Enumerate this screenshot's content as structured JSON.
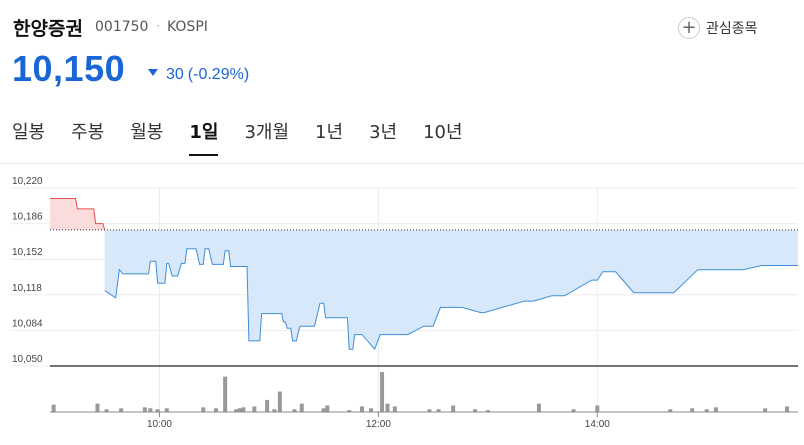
{
  "header": {
    "stock_name": "한양증권",
    "stock_code": "001750",
    "separator": "·",
    "market": "KOSPI",
    "favorite_label": "관심종목",
    "favorite_icon": "plus-circle-icon"
  },
  "quote": {
    "price": "10,150",
    "change": "30",
    "change_pct": "(-0.29%)",
    "direction": "down",
    "color": "#1a66d6"
  },
  "tabs": [
    {
      "label": "일봉",
      "active": false
    },
    {
      "label": "주봉",
      "active": false
    },
    {
      "label": "월봉",
      "active": false
    },
    {
      "label": "1일",
      "active": true
    },
    {
      "label": "3개월",
      "active": false
    },
    {
      "label": "1년",
      "active": false
    },
    {
      "label": "3년",
      "active": false
    },
    {
      "label": "10년",
      "active": false
    }
  ],
  "chart_data": {
    "type": "area",
    "x_unit": "minutes since 09:00",
    "reference_price": 10180,
    "up_color": "#e05050",
    "down_color": "#3f8fd8",
    "ylim": [
      10050,
      10220
    ],
    "yticks": [
      "10,220",
      "10,186",
      "10,152",
      "10,118",
      "10,084",
      "10,050"
    ],
    "ytick_values": [
      10220,
      10186,
      10152,
      10118,
      10084,
      10050
    ],
    "xticks": [
      "10:00",
      "12:00",
      "14:00"
    ],
    "xtick_values": [
      60,
      180,
      300
    ],
    "xlim": [
      0,
      410
    ],
    "series": [
      {
        "x": [
          0,
          14,
          15,
          24,
          25,
          29,
          30,
          36,
          38,
          40,
          43,
          54,
          55,
          58,
          59,
          63,
          64,
          65,
          67,
          70,
          72,
          74,
          75,
          80,
          82,
          84,
          85,
          87,
          89,
          90,
          95,
          96,
          98,
          99,
          105,
          108,
          109,
          115,
          116,
          122,
          127,
          128,
          129,
          130,
          132,
          133,
          134,
          135,
          137,
          145,
          148,
          149,
          150,
          151,
          163,
          164,
          166,
          167,
          171,
          178,
          181,
          185,
          186,
          196,
          205,
          210,
          214,
          225,
          226,
          236,
          238,
          260,
          264,
          265,
          275,
          282,
          297,
          300,
          303,
          310,
          320,
          340,
          342,
          355,
          380,
          390,
          395,
          400,
          410
        ],
        "y": [
          10210,
          10210,
          10200,
          10200,
          10186,
          10186,
          10122,
          10115,
          10142,
          10138,
          10138,
          10138,
          10150,
          10150,
          10129,
          10129,
          10148,
          10148,
          10136,
          10136,
          10148,
          10148,
          10162,
          10162,
          10147,
          10147,
          10162,
          10162,
          10147,
          10147,
          10147,
          10160,
          10160,
          10145,
          10145,
          10145,
          10074,
          10074,
          10100,
          10100,
          10100,
          10092,
          10092,
          10086,
          10086,
          10074,
          10074,
          10074,
          10088,
          10088,
          10110,
          10110,
          10110,
          10096,
          10096,
          10066,
          10066,
          10080,
          10080,
          10066,
          10080,
          10080,
          10080,
          10080,
          10088,
          10088,
          10106,
          10106,
          10106,
          10101,
          10101,
          10112,
          10112,
          10112,
          10117,
          10117,
          10132,
          10132,
          10140,
          10140,
          10120,
          10120,
          10120,
          10142,
          10142,
          10146,
          10146,
          10146,
          10146
        ],
        "name": ""
      }
    ],
    "volume": {
      "x": [
        2,
        26,
        31,
        39,
        52,
        55,
        59,
        64,
        84,
        91,
        96,
        102,
        104,
        106,
        112,
        119,
        123,
        126,
        134,
        138,
        150,
        152,
        164,
        171,
        176,
        182,
        185,
        189,
        208,
        213,
        221,
        233,
        240,
        268,
        287,
        300,
        340,
        352,
        360,
        365,
        392,
        404
      ],
      "v": [
        8,
        9,
        3,
        4,
        5,
        4,
        3,
        4,
        5,
        4,
        38,
        3,
        4,
        5,
        6,
        13,
        3,
        22,
        3,
        9,
        4,
        7,
        2,
        6,
        4,
        43,
        9,
        6,
        3,
        3,
        7,
        3,
        2,
        9,
        3,
        7,
        3,
        4,
        3,
        5,
        4,
        6
      ]
    }
  }
}
